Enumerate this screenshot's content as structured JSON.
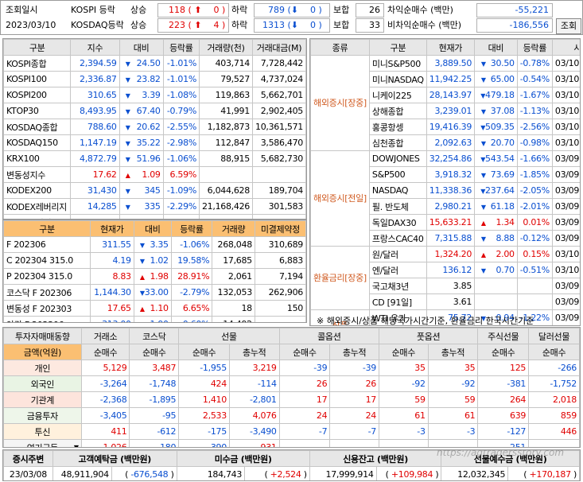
{
  "top": {
    "query_label": "조회일시",
    "query_date": "2023/03/10",
    "rows": [
      {
        "market": "KOSPI 등락",
        "up_label": "상승",
        "up": "118",
        "up_delta": "0",
        "down_label": "하락",
        "down": "789",
        "down_delta": "0",
        "flat_label": "보합",
        "flat": "26",
        "net_label": "차익순매수 (백만)",
        "net": "-55,221"
      },
      {
        "market": "KOSDAQ등락",
        "up_label": "상승",
        "up": "223",
        "up_delta": "4",
        "down_label": "하락",
        "down": "1313",
        "down_delta": "0",
        "flat_label": "보합",
        "flat": "33",
        "net_label": "비차익순매수 (백만)",
        "net": "-186,556"
      }
    ],
    "query_button": "조회"
  },
  "idx": {
    "headers": [
      "구분",
      "지수",
      "대비",
      "등락률",
      "거래량(천)",
      "거래대금(M)"
    ],
    "rows": [
      {
        "name": "KOSPI종합",
        "v": "2,394.59",
        "dir": "dn",
        "chg": "24.50",
        "rate": "-1.01%",
        "vol": "403,714",
        "amt": "7,728,442"
      },
      {
        "name": "KOSPI100",
        "v": "2,336.87",
        "dir": "dn",
        "chg": "23.82",
        "rate": "-1.01%",
        "vol": "79,527",
        "amt": "4,737,024"
      },
      {
        "name": "KOSPI200",
        "v": "310.65",
        "dir": "dn",
        "chg": "3.39",
        "rate": "-1.08%",
        "vol": "119,863",
        "amt": "5,662,701"
      },
      {
        "name": "KTOP30",
        "v": "8,493.95",
        "dir": "dn",
        "chg": "67.40",
        "rate": "-0.79%",
        "vol": "41,991",
        "amt": "2,902,405"
      },
      {
        "name": "KOSDAQ종합",
        "v": "788.60",
        "dir": "dn",
        "chg": "20.62",
        "rate": "-2.55%",
        "vol": "1,182,873",
        "amt": "10,361,571"
      },
      {
        "name": "KOSDAQ150",
        "v": "1,147.19",
        "dir": "dn",
        "chg": "35.22",
        "rate": "-2.98%",
        "vol": "112,847",
        "amt": "3,586,470"
      },
      {
        "name": "KRX100",
        "v": "4,872.79",
        "dir": "dn",
        "chg": "51.96",
        "rate": "-1.06%",
        "vol": "88,915",
        "amt": "5,682,730"
      },
      {
        "name": "변동성지수",
        "v": "17.62",
        "dir": "up",
        "chg": "1.09",
        "rate": "6.59%",
        "vol": "",
        "amt": ""
      },
      {
        "name": "KODEX200",
        "v": "31,430",
        "dir": "dn",
        "chg": "345",
        "rate": "-1.09%",
        "vol": "6,044,628",
        "amt": "189,704"
      },
      {
        "name": "KODEX레버리지",
        "v": "14,285",
        "dir": "dn",
        "chg": "335",
        "rate": "-2.29%",
        "vol": "21,168,426",
        "amt": "301,583"
      },
      {
        "name": "KODEX인버스",
        "v": "4,895",
        "dir": "up",
        "chg": "55",
        "rate": "1.14%",
        "vol": "25,557,026",
        "amt": "125,279"
      }
    ]
  },
  "fut": {
    "headers": [
      "구분",
      "현재가",
      "대비",
      "등락률",
      "거래량",
      "미결제약정"
    ],
    "rows": [
      {
        "name": "F 202306",
        "v": "311.55",
        "dir": "dn",
        "chg": "3.35",
        "rate": "-1.06%",
        "vol": "268,048",
        "oi": "310,689"
      },
      {
        "name": "C 202304 315.0",
        "v": "4.19",
        "dir": "dn",
        "chg": "1.02",
        "rate": "19.58%",
        "vol": "17,685",
        "oi": "6,883"
      },
      {
        "name": "P 202304 315.0",
        "v": "8.83",
        "dir": "up",
        "chg": "1.98",
        "rate": "28.91%",
        "vol": "2,061",
        "oi": "7,194"
      },
      {
        "name": "코스닥 F 202306",
        "v": "1,144.30",
        "dir": "dn",
        "chg": "33.00",
        "rate": "-2.79%",
        "vol": "132,053",
        "oi": "262,906"
      },
      {
        "name": "변동성 F 202303",
        "v": "17.65",
        "dir": "up",
        "chg": "1.10",
        "rate": "6.65%",
        "vol": "18",
        "oi": "150"
      },
      {
        "name": "야간 F 202306",
        "v": "313.00",
        "dir": "dn",
        "chg": "1.90",
        "rate": "-0.60%",
        "vol": "14,492",
        "oi": ""
      }
    ]
  },
  "world": {
    "headers": [
      "종류",
      "구분",
      "현재가",
      "대비",
      "등락률",
      "시간"
    ],
    "groups": [
      {
        "label": "해외증시[장중]",
        "rows": [
          {
            "name": "미니S&P500",
            "v": "3,889.50",
            "dir": "dn",
            "chg": "30.50",
            "rate": "-0.78%",
            "date": "03/10",
            "time": "15:30"
          },
          {
            "name": "미니NASDAQ",
            "v": "11,942.25",
            "dir": "dn",
            "chg": "65.00",
            "rate": "-0.54%",
            "date": "03/10",
            "time": "15:30"
          },
          {
            "name": "니케이225",
            "v": "28,143.97",
            "dir": "dn",
            "chg": "479.18",
            "rate": "-1.67%",
            "date": "03/10",
            "time": "15:00"
          },
          {
            "name": "상해종합",
            "v": "3,239.01",
            "dir": "dn",
            "chg": "37.08",
            "rate": "-1.13%",
            "date": "03/10",
            "time": "14:25"
          },
          {
            "name": "홍콩항셍",
            "v": "19,416.39",
            "dir": "dn",
            "chg": "509.35",
            "rate": "-2.56%",
            "date": "03/10",
            "time": "14:25"
          },
          {
            "name": "심천종합",
            "v": "2,092.63",
            "dir": "dn",
            "chg": "20.70",
            "rate": "-0.98%",
            "date": "03/10",
            "time": "14:25"
          }
        ]
      },
      {
        "label": "해외증시[전일]",
        "rows": [
          {
            "name": "DOWJONES",
            "v": "32,254.86",
            "dir": "dn",
            "chg": "543.54",
            "rate": "-1.66%",
            "date": "03/09",
            "time": "16:00"
          },
          {
            "name": "S&P500",
            "v": "3,918.32",
            "dir": "dn",
            "chg": "73.69",
            "rate": "-1.85%",
            "date": "03/09",
            "time": "17:08"
          },
          {
            "name": "NASDAQ",
            "v": "11,338.36",
            "dir": "dn",
            "chg": "237.64",
            "rate": "-2.05%",
            "date": "03/09",
            "time": "16:15"
          },
          {
            "name": "필. 반도체",
            "v": "2,980.21",
            "dir": "dn",
            "chg": "61.18",
            "rate": "-2.01%",
            "date": "03/09",
            "time": "16:15"
          },
          {
            "name": "독일DAX30",
            "v": "15,633.21",
            "dir": "up",
            "chg": "1.34",
            "rate": "0.01%",
            "date": "03/09",
            "time": "16:00"
          },
          {
            "name": "프랑스CAC40",
            "v": "7,315.88",
            "dir": "dn",
            "chg": "8.88",
            "rate": "-0.12%",
            "date": "03/09",
            "time": "16:00"
          }
        ]
      },
      {
        "label": "환율금리[장중]",
        "rows": [
          {
            "name": "원/달러",
            "v": "1,324.20",
            "dir": "up",
            "chg": "2.00",
            "rate": "0.15%",
            "date": "03/10",
            "time": "15:30"
          },
          {
            "name": "엔/달러",
            "v": "136.12",
            "dir": "dn",
            "chg": "0.70",
            "rate": "-0.51%",
            "date": "03/10",
            "time": "15:30"
          },
          {
            "name": "국고채3년",
            "v": "3.85",
            "dir": "",
            "chg": "",
            "rate": "",
            "date": "03/09",
            "time": "16:00"
          },
          {
            "name": "CD [91일]",
            "v": "3.61",
            "dir": "",
            "chg": "",
            "rate": "",
            "date": "03/09",
            "time": "16:00"
          }
        ]
      },
      {
        "label": "상품",
        "rows": [
          {
            "name": "WTI 유가",
            "v": "75.72",
            "dir": "dn",
            "chg": "0.94",
            "rate": "-1.22%",
            "date": "03/09",
            "time": "16:00"
          },
          {
            "name": "금",
            "v": "1,834.60",
            "dir": "up",
            "chg": "16.00",
            "rate": "0.87%",
            "date": "03/09",
            "time": "16:00"
          }
        ]
      }
    ],
    "note": "※ 해외증시/상품 해당국가시간기준, 환율금리 한국시간기준"
  },
  "investor": {
    "h1": [
      "투자자매매동향",
      "거래소",
      "코스닥",
      "선물",
      "콜옵션",
      "풋옵션",
      "주식선물",
      "달러선물"
    ],
    "h2": [
      "금액(억원)",
      "순매수",
      "순매수",
      "순매수",
      "총누적",
      "순매수",
      "총누적",
      "순매수",
      "총누적",
      "순매수",
      "순매수"
    ],
    "rows": [
      {
        "name": "개인",
        "vals": [
          "5,129",
          "3,487",
          "-1,955",
          "3,219",
          "-39",
          "-39",
          "35",
          "35",
          "125",
          "-266"
        ]
      },
      {
        "name": "외국인",
        "vals": [
          "-3,264",
          "-1,748",
          "424",
          "-114",
          "26",
          "26",
          "-92",
          "-92",
          "-381",
          "-1,752"
        ]
      },
      {
        "name": "기관계",
        "vals": [
          "-2,368",
          "-1,895",
          "1,410",
          "-2,801",
          "17",
          "17",
          "59",
          "59",
          "264",
          "2,018"
        ]
      },
      {
        "name": "금융투자",
        "vals": [
          "-3,405",
          "-95",
          "2,533",
          "4,076",
          "24",
          "24",
          "61",
          "61",
          "639",
          "859"
        ]
      },
      {
        "name": "투신",
        "vals": [
          "411",
          "-612",
          "-175",
          "-3,490",
          "-7",
          "-7",
          "-3",
          "-3",
          "-127",
          "446"
        ]
      },
      {
        "name": "연기금등",
        "vals": [
          "1,026",
          "-180",
          "-390",
          "931",
          "",
          "",
          "",
          "",
          "-251",
          ""
        ]
      }
    ]
  },
  "bottom": {
    "headers": [
      "증시주변",
      "고객예탁금 (백만원)",
      "미수금 (백만원)",
      "신용잔고 (백만원)",
      "선물예수금 (백만원)"
    ],
    "date": "23/03/08",
    "deposit": "48,911,904",
    "deposit_chg": "-676,548",
    "unpaid": "184,743",
    "unpaid_chg": "+2,524",
    "credit": "17,999,914",
    "credit_chg": "+109,984",
    "futdep": "12,032,345",
    "futdep_chg": "+170,187",
    "watermark": "https://adtradersstory.com"
  }
}
